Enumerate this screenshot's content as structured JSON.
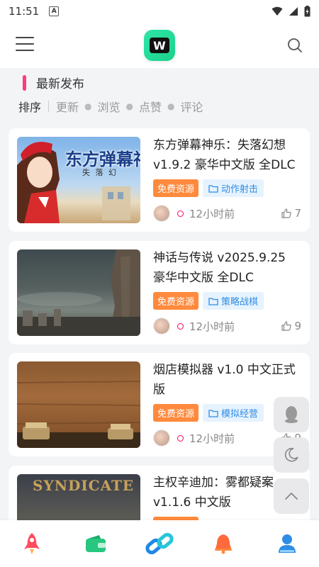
{
  "status_bar": {
    "time": "11:51",
    "a_label": "A"
  },
  "section": {
    "title": "最新发布"
  },
  "sort": {
    "label": "排序",
    "options": [
      "更新",
      "浏览",
      "点赞",
      "评论"
    ]
  },
  "posts": [
    {
      "title": "东方弹幕神乐：失落幻想 v1.9.2 豪华中文版 全DLC",
      "free": "免费资源",
      "category": "动作射击",
      "time": "12小时前",
      "likes": "7"
    },
    {
      "title": "神话与传说 v2025.9.25 豪华中文版 全DLC",
      "free": "免费资源",
      "category": "策略战棋",
      "time": "12小时前",
      "likes": "9"
    },
    {
      "title": "烟店模拟器 v1.0 中文正式版",
      "free": "免费资源",
      "category": "模拟经营",
      "time": "12小时前",
      "likes": "9"
    },
    {
      "title": "主权辛迪加：雾都疑案 v1.1.6 中文版",
      "free": "免费资源",
      "category": "",
      "time": "",
      "likes": ""
    }
  ],
  "thumb_text": {
    "p1_main": "东方弹幕神",
    "p1_sub": "失 落 幻",
    "p4_main": "SYNDICATE"
  },
  "colors": {
    "accent_pink": "#ff3b7b",
    "tag_orange": "#ff8a3d",
    "tag_blue": "#2f8de4"
  },
  "icons": {
    "header": [
      "menu-icon",
      "logo-icon",
      "search-icon"
    ],
    "float": [
      "qq-icon",
      "moon-icon",
      "chevron-up-icon"
    ],
    "nav": [
      "rocket-icon",
      "wallet-icon",
      "link-icon",
      "bell-icon",
      "user-icon"
    ]
  }
}
